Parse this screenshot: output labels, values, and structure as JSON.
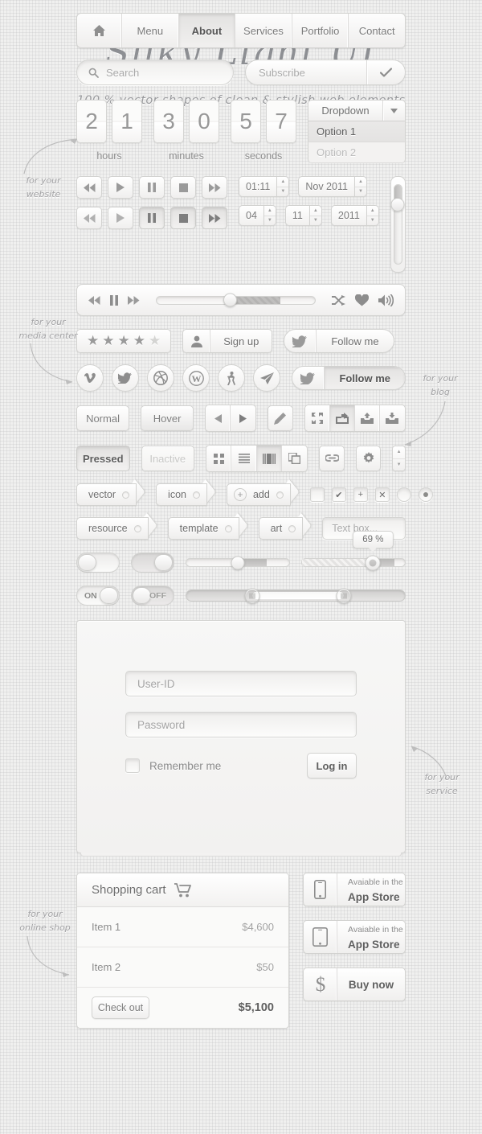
{
  "header": {
    "title": "Silky Light UI",
    "subtitle": "100 % vector shapes of clean & stylish web elements"
  },
  "nav": {
    "home_icon": "home-icon",
    "items": [
      {
        "label": "Menu",
        "active": false
      },
      {
        "label": "About",
        "active": true
      },
      {
        "label": "Services",
        "active": false
      },
      {
        "label": "Portfolio",
        "active": false
      },
      {
        "label": "Contact",
        "active": false
      }
    ]
  },
  "search": {
    "placeholder": "Search",
    "icon": "search-icon"
  },
  "subscribe": {
    "placeholder": "Subscribe",
    "submit_icon": "check-icon"
  },
  "countdown": {
    "groups": [
      {
        "label": "hours",
        "d1": "2",
        "d2": "1"
      },
      {
        "label": "minutes",
        "d1": "3",
        "d2": "0"
      },
      {
        "label": "seconds",
        "d1": "5",
        "d2": "7"
      }
    ]
  },
  "dropdown": {
    "label": "Dropdown",
    "arrow_icon": "chevron-down-icon",
    "options": [
      {
        "label": "Option 1",
        "state": "selected"
      },
      {
        "label": "Option 2",
        "state": "disabled"
      }
    ]
  },
  "media": {
    "buttons_row1": [
      "rewind-icon",
      "play-icon",
      "pause-icon",
      "stop-icon",
      "forward-icon"
    ],
    "buttons_row2": [
      "rewind-icon",
      "play-icon",
      "pause-icon",
      "stop-icon",
      "forward-icon"
    ],
    "steppers_row1": [
      "01:11",
      "Nov 2011"
    ],
    "steppers_row2": [
      "04",
      "11",
      "2011"
    ]
  },
  "player": {
    "prev_icon": "rewind-icon",
    "pause_icon": "pause-icon",
    "next_icon": "forward-icon",
    "shuffle_icon": "shuffle-icon",
    "heart_icon": "heart-icon",
    "volume_icon": "volume-icon"
  },
  "rating": {
    "filled": 4,
    "total": 5,
    "star_icon": "star-icon"
  },
  "signup": {
    "label": "Sign up",
    "icon": "user-icon"
  },
  "follow": {
    "normal_label": "Follow me",
    "pressed_label": "Follow me",
    "icon": "twitter-bird-icon"
  },
  "socials": [
    {
      "name": "vimeo-icon",
      "glyph": "v"
    },
    {
      "name": "twitter-icon",
      "glyph": "t"
    },
    {
      "name": "dribbble-icon",
      "glyph": "d"
    },
    {
      "name": "wordpress-icon",
      "glyph": "W"
    },
    {
      "name": "forrst-icon",
      "glyph": "f"
    },
    {
      "name": "paper-plane-icon",
      "glyph": "p"
    }
  ],
  "button_states": [
    {
      "label": "Normal",
      "state": "normal"
    },
    {
      "label": "Hover",
      "state": "hover"
    },
    {
      "label": "Pressed",
      "state": "pressed"
    },
    {
      "label": "Inactive",
      "state": "inactive"
    }
  ],
  "toolbars": {
    "arrows": [
      "arrow-left-icon",
      "arrow-right-icon"
    ],
    "pencil": "pencil-icon",
    "actions": [
      "fullscreen-icon",
      "share-icon",
      "upload-icon",
      "download-icon"
    ],
    "views": [
      "grid-view-icon",
      "list-view-icon",
      "column-view-icon",
      "copy-icon"
    ],
    "link": "link-icon",
    "gear": "gear-icon",
    "stepper": "stepper-icon"
  },
  "tags": {
    "row1": [
      "vector",
      "icon",
      "add"
    ],
    "row2": [
      "resource",
      "template",
      "art"
    ],
    "add_icon": "plus-circle-icon"
  },
  "checkboxes": [
    {
      "name": "checkbox-empty",
      "glyph": ""
    },
    {
      "name": "checkbox-checked",
      "glyph": "✔"
    },
    {
      "name": "checkbox-plus",
      "glyph": "+"
    },
    {
      "name": "checkbox-cross",
      "glyph": "✕"
    },
    {
      "name": "radio-empty",
      "glyph": ""
    },
    {
      "name": "radio-selected",
      "glyph": "•"
    }
  ],
  "textbox": {
    "placeholder": "Text box..."
  },
  "toggles": [
    {
      "name": "toggle-off-plain",
      "position": "left",
      "label": ""
    },
    {
      "name": "toggle-on-plain",
      "position": "right",
      "label": ""
    },
    {
      "name": "toggle-on",
      "position": "right",
      "label": "ON"
    },
    {
      "name": "toggle-off",
      "position": "left",
      "label": "OFF"
    }
  ],
  "sliders": {
    "slider1_value": 57,
    "slider2_value": 69,
    "slider2_tooltip": "69 %",
    "range_low": 30,
    "range_high": 72,
    "vertical_value": 78
  },
  "login": {
    "userid_placeholder": "User-ID",
    "password_placeholder": "Password",
    "remember_label": "Remember me",
    "login_button": "Log in"
  },
  "cart": {
    "title": "Shopping cart",
    "cart_icon": "shopping-cart-icon",
    "items": [
      {
        "name": "Item 1",
        "price": "$4,600"
      },
      {
        "name": "Item 2",
        "price": "$50"
      }
    ],
    "checkout_label": "Check out",
    "total": "$5,100"
  },
  "store_buttons": [
    {
      "small": "Avaiable in the",
      "big": "App Store",
      "icon": "iphone-icon"
    },
    {
      "small": "Avaiable in the",
      "big": "App Store",
      "icon": "ipad-icon"
    },
    {
      "big": "Buy now",
      "icon": "dollar-icon"
    }
  ],
  "annotations": [
    {
      "name": "note-website",
      "lines": [
        "for your",
        "website"
      ]
    },
    {
      "name": "note-media-center",
      "lines": [
        "for your",
        "media center"
      ]
    },
    {
      "name": "note-blog",
      "lines": [
        "for your",
        "blog"
      ]
    },
    {
      "name": "note-service",
      "lines": [
        "for your",
        "service"
      ]
    },
    {
      "name": "note-online-shop",
      "lines": [
        "for your",
        "online shop"
      ]
    }
  ],
  "colors": {
    "background": "#f0f0ef",
    "text": "#7d7d7d",
    "accent": "#8d8f93"
  }
}
